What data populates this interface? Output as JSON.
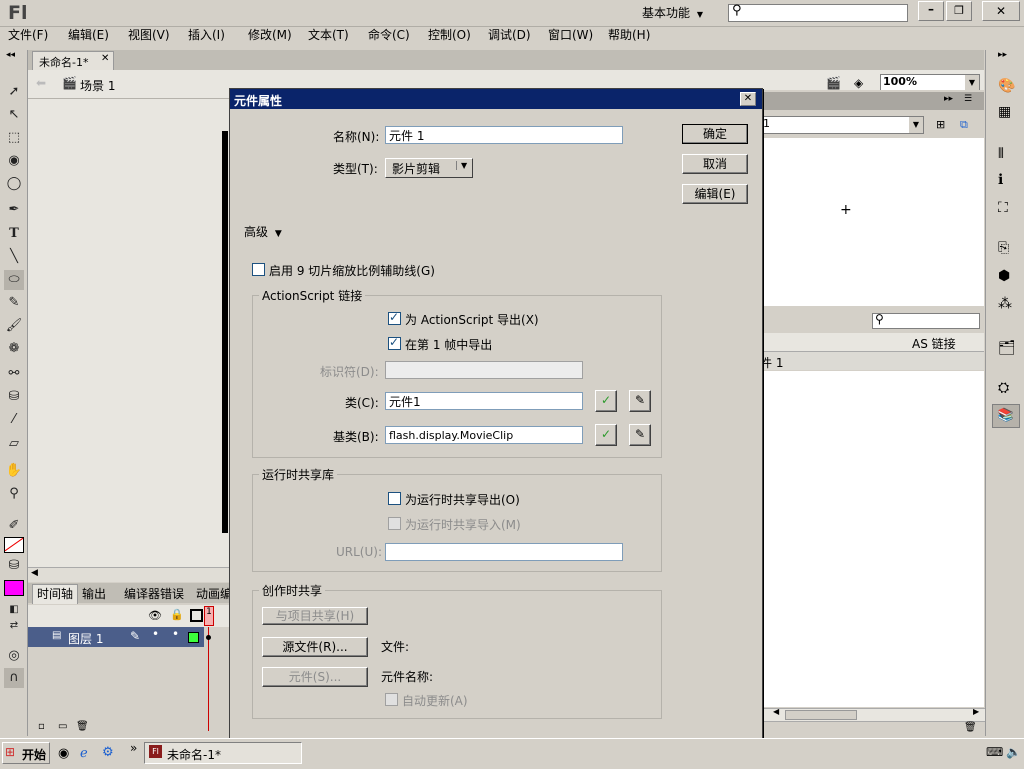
{
  "app": {
    "logo": "Fl",
    "workspace": "基本功能",
    "search_placeholder": ""
  },
  "menu": [
    "文件(F)",
    "编辑(E)",
    "视图(V)",
    "插入(I)",
    "修改(M)",
    "文本(T)",
    "命令(C)",
    "控制(O)",
    "调试(D)",
    "窗口(W)",
    "帮助(H)"
  ],
  "document": {
    "tab": "未命名-1*",
    "scene": "场景 1",
    "zoom": "100%"
  },
  "timeline": {
    "tabs": [
      "时间轴",
      "输出",
      "编译器错误",
      "动画编"
    ],
    "layer": "图层 1",
    "frame": "1"
  },
  "library": {
    "col_linkage": "AS 链接",
    "item": "件 1",
    "dropdown": "1"
  },
  "dialog": {
    "title": "元件属性",
    "name_label": "名称(N):",
    "name_value": "元件 1",
    "type_label": "类型(T):",
    "type_value": "影片剪辑",
    "ok": "确定",
    "cancel": "取消",
    "edit": "编辑(E)",
    "advanced": "高级",
    "nine_slice": "启用 9 切片缩放比例辅助线(G)",
    "as_group": "ActionScript 链接",
    "export_as": "为 ActionScript 导出(X)",
    "export_frame1": "在第 1 帧中导出",
    "identifier_label": "标识符(D):",
    "identifier_value": "",
    "class_label": "类(C):",
    "class_value": "元件1",
    "base_label": "基类(B):",
    "base_value": "flash.display.MovieClip",
    "runtime_group": "运行时共享库",
    "runtime_export": "为运行时共享导出(O)",
    "runtime_import": "为运行时共享导入(M)",
    "url_label": "URL(U):",
    "url_value": "",
    "author_group": "创作时共享",
    "share_project": "与项目共享(H)",
    "source_file": "源文件(R)...",
    "file_label": "文件:",
    "symbol_btn": "元件(S)...",
    "symbol_name_label": "元件名称:",
    "auto_update": "自动更新(A)"
  },
  "taskbar": {
    "start": "开始",
    "task": "未命名-1*",
    "more": "»"
  }
}
